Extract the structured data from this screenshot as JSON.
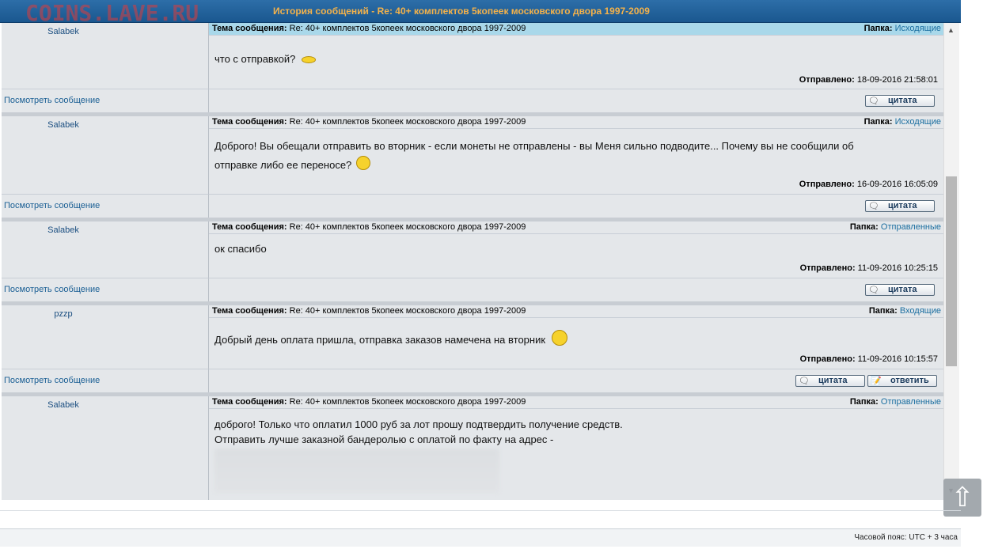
{
  "header": {
    "watermark": "COINS.LAVE.RU",
    "title": "История сообщений - Re: 40+ комплектов 5копеек московского двора 1997-2009"
  },
  "labels": {
    "subject": "Тема сообщения:",
    "folder": "Папка:",
    "sent": "Отправлено:",
    "view_message": "Посмотреть сообщение",
    "quote": "цитата",
    "reply": "ответить"
  },
  "posts": [
    {
      "author": "Salabek",
      "subject": "Re: 40+ комплектов 5копеек московского двора 1997-2009",
      "folder": "Исходящие",
      "text_lines": [
        "что с отправкой?"
      ],
      "sent": "18-09-2016 21:58:01",
      "highlighted": true
    },
    {
      "author": "Salabek",
      "subject": "Re: 40+ комплектов 5копеек московского двора 1997-2009",
      "folder": "Исходящие",
      "text_lines": [
        "Доброго! Вы обещали отправить во вторник - если монеты не отправлены - вы Меня сильно подводите... Почему вы не сообщили об",
        "отправке либо ее переносе?"
      ],
      "sent": "16-09-2016 16:05:09"
    },
    {
      "author": "Salabek",
      "subject": "Re: 40+ комплектов 5копеек московского двора 1997-2009",
      "folder": "Отправленные",
      "text_lines": [
        "ок спасибо"
      ],
      "sent": "11-09-2016 10:25:15"
    },
    {
      "author": "pzzp",
      "subject": "Re: 40+ комплектов 5копеек московского двора 1997-2009",
      "folder": "Входящие",
      "text_lines": [
        "Добрый день оплата пришла, отправка заказов намечена на вторник"
      ],
      "sent": "11-09-2016 10:15:57"
    },
    {
      "author": "Salabek",
      "subject": "Re: 40+ комплектов 5копеек московского двора 1997-2009",
      "folder": "Отправленные",
      "text_lines": [
        "доброго! Только что оплатил 1000 руб за лот прошу подтвердить получение средств.",
        "Отправить лучше заказной бандеролью с оплатой по факту на адрес -"
      ]
    }
  ],
  "footer": {
    "timezone": "Часовой пояс: UTC + 3 часа"
  },
  "colors": {
    "header_bg": "#1f5f98",
    "title": "#f4b24a",
    "link": "#1a6ea0",
    "row_bg": "#e4e7ea",
    "highlight": "#a9d8ea"
  }
}
